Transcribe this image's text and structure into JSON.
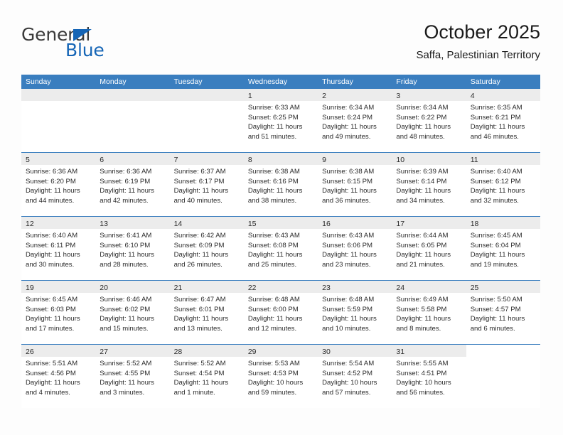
{
  "logo": {
    "word_top": "General",
    "word_bottom": "Blue",
    "accent_color": "#1565b6",
    "icon": "triangle-icon"
  },
  "header": {
    "title": "October 2025",
    "subtitle": "Saffa, Palestinian Territory"
  },
  "theme": {
    "header_blue": "#3a7ebf",
    "day_band_gray": "#ececec",
    "page_background": "#fdfdfd"
  },
  "weekdays": [
    "Sunday",
    "Monday",
    "Tuesday",
    "Wednesday",
    "Thursday",
    "Friday",
    "Saturday"
  ],
  "weeks": [
    [
      {
        "day": "",
        "lines": []
      },
      {
        "day": "",
        "lines": []
      },
      {
        "day": "",
        "lines": []
      },
      {
        "day": "1",
        "lines": [
          "Sunrise: 6:33 AM",
          "Sunset: 6:25 PM",
          "Daylight: 11 hours",
          "and 51 minutes."
        ]
      },
      {
        "day": "2",
        "lines": [
          "Sunrise: 6:34 AM",
          "Sunset: 6:24 PM",
          "Daylight: 11 hours",
          "and 49 minutes."
        ]
      },
      {
        "day": "3",
        "lines": [
          "Sunrise: 6:34 AM",
          "Sunset: 6:22 PM",
          "Daylight: 11 hours",
          "and 48 minutes."
        ]
      },
      {
        "day": "4",
        "lines": [
          "Sunrise: 6:35 AM",
          "Sunset: 6:21 PM",
          "Daylight: 11 hours",
          "and 46 minutes."
        ]
      }
    ],
    [
      {
        "day": "5",
        "lines": [
          "Sunrise: 6:36 AM",
          "Sunset: 6:20 PM",
          "Daylight: 11 hours",
          "and 44 minutes."
        ]
      },
      {
        "day": "6",
        "lines": [
          "Sunrise: 6:36 AM",
          "Sunset: 6:19 PM",
          "Daylight: 11 hours",
          "and 42 minutes."
        ]
      },
      {
        "day": "7",
        "lines": [
          "Sunrise: 6:37 AM",
          "Sunset: 6:17 PM",
          "Daylight: 11 hours",
          "and 40 minutes."
        ]
      },
      {
        "day": "8",
        "lines": [
          "Sunrise: 6:38 AM",
          "Sunset: 6:16 PM",
          "Daylight: 11 hours",
          "and 38 minutes."
        ]
      },
      {
        "day": "9",
        "lines": [
          "Sunrise: 6:38 AM",
          "Sunset: 6:15 PM",
          "Daylight: 11 hours",
          "and 36 minutes."
        ]
      },
      {
        "day": "10",
        "lines": [
          "Sunrise: 6:39 AM",
          "Sunset: 6:14 PM",
          "Daylight: 11 hours",
          "and 34 minutes."
        ]
      },
      {
        "day": "11",
        "lines": [
          "Sunrise: 6:40 AM",
          "Sunset: 6:12 PM",
          "Daylight: 11 hours",
          "and 32 minutes."
        ]
      }
    ],
    [
      {
        "day": "12",
        "lines": [
          "Sunrise: 6:40 AM",
          "Sunset: 6:11 PM",
          "Daylight: 11 hours",
          "and 30 minutes."
        ]
      },
      {
        "day": "13",
        "lines": [
          "Sunrise: 6:41 AM",
          "Sunset: 6:10 PM",
          "Daylight: 11 hours",
          "and 28 minutes."
        ]
      },
      {
        "day": "14",
        "lines": [
          "Sunrise: 6:42 AM",
          "Sunset: 6:09 PM",
          "Daylight: 11 hours",
          "and 26 minutes."
        ]
      },
      {
        "day": "15",
        "lines": [
          "Sunrise: 6:43 AM",
          "Sunset: 6:08 PM",
          "Daylight: 11 hours",
          "and 25 minutes."
        ]
      },
      {
        "day": "16",
        "lines": [
          "Sunrise: 6:43 AM",
          "Sunset: 6:06 PM",
          "Daylight: 11 hours",
          "and 23 minutes."
        ]
      },
      {
        "day": "17",
        "lines": [
          "Sunrise: 6:44 AM",
          "Sunset: 6:05 PM",
          "Daylight: 11 hours",
          "and 21 minutes."
        ]
      },
      {
        "day": "18",
        "lines": [
          "Sunrise: 6:45 AM",
          "Sunset: 6:04 PM",
          "Daylight: 11 hours",
          "and 19 minutes."
        ]
      }
    ],
    [
      {
        "day": "19",
        "lines": [
          "Sunrise: 6:45 AM",
          "Sunset: 6:03 PM",
          "Daylight: 11 hours",
          "and 17 minutes."
        ]
      },
      {
        "day": "20",
        "lines": [
          "Sunrise: 6:46 AM",
          "Sunset: 6:02 PM",
          "Daylight: 11 hours",
          "and 15 minutes."
        ]
      },
      {
        "day": "21",
        "lines": [
          "Sunrise: 6:47 AM",
          "Sunset: 6:01 PM",
          "Daylight: 11 hours",
          "and 13 minutes."
        ]
      },
      {
        "day": "22",
        "lines": [
          "Sunrise: 6:48 AM",
          "Sunset: 6:00 PM",
          "Daylight: 11 hours",
          "and 12 minutes."
        ]
      },
      {
        "day": "23",
        "lines": [
          "Sunrise: 6:48 AM",
          "Sunset: 5:59 PM",
          "Daylight: 11 hours",
          "and 10 minutes."
        ]
      },
      {
        "day": "24",
        "lines": [
          "Sunrise: 6:49 AM",
          "Sunset: 5:58 PM",
          "Daylight: 11 hours",
          "and 8 minutes."
        ]
      },
      {
        "day": "25",
        "lines": [
          "Sunrise: 5:50 AM",
          "Sunset: 4:57 PM",
          "Daylight: 11 hours",
          "and 6 minutes."
        ]
      }
    ],
    [
      {
        "day": "26",
        "lines": [
          "Sunrise: 5:51 AM",
          "Sunset: 4:56 PM",
          "Daylight: 11 hours",
          "and 4 minutes."
        ]
      },
      {
        "day": "27",
        "lines": [
          "Sunrise: 5:52 AM",
          "Sunset: 4:55 PM",
          "Daylight: 11 hours",
          "and 3 minutes."
        ]
      },
      {
        "day": "28",
        "lines": [
          "Sunrise: 5:52 AM",
          "Sunset: 4:54 PM",
          "Daylight: 11 hours",
          "and 1 minute."
        ]
      },
      {
        "day": "29",
        "lines": [
          "Sunrise: 5:53 AM",
          "Sunset: 4:53 PM",
          "Daylight: 10 hours",
          "and 59 minutes."
        ]
      },
      {
        "day": "30",
        "lines": [
          "Sunrise: 5:54 AM",
          "Sunset: 4:52 PM",
          "Daylight: 10 hours",
          "and 57 minutes."
        ]
      },
      {
        "day": "31",
        "lines": [
          "Sunrise: 5:55 AM",
          "Sunset: 4:51 PM",
          "Daylight: 10 hours",
          "and 56 minutes."
        ]
      }
    ]
  ]
}
